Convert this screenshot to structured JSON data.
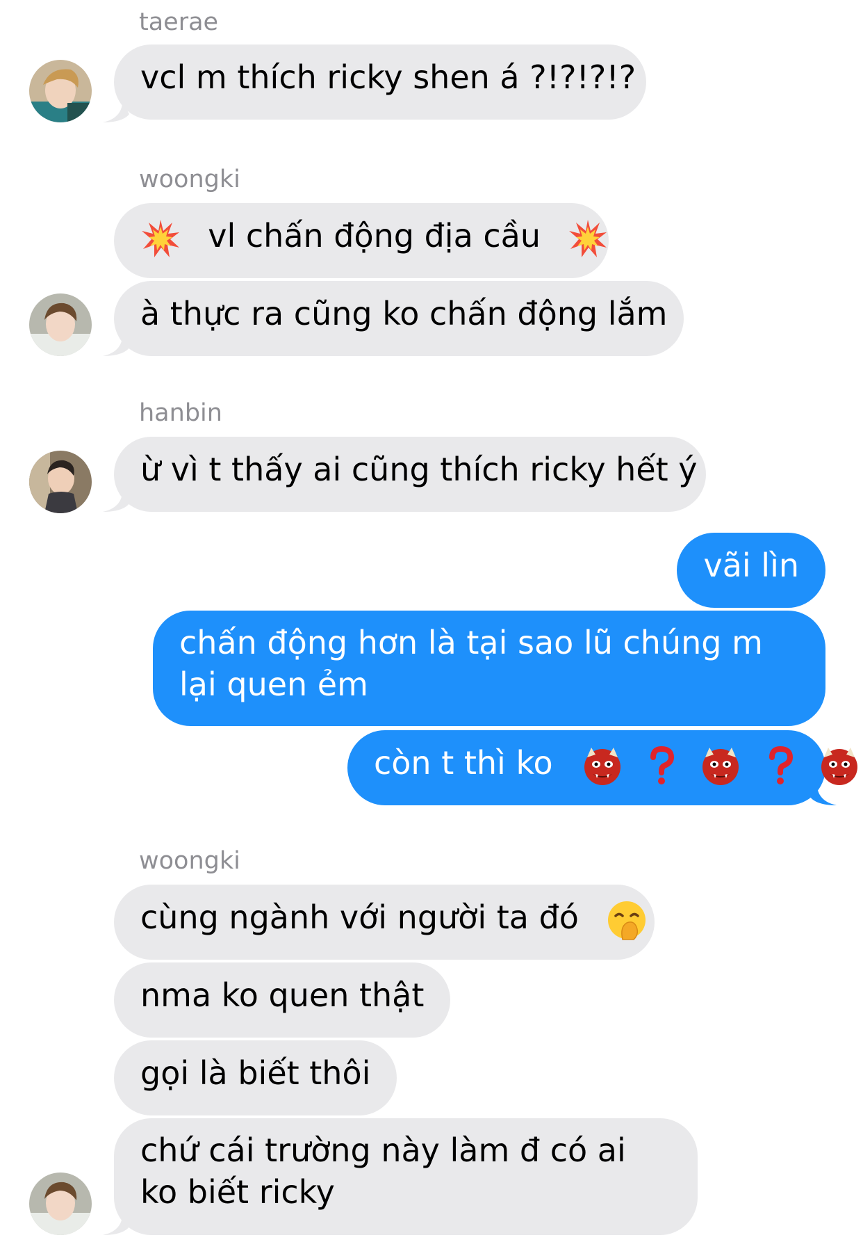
{
  "groups": [
    {
      "sender": "taerae",
      "messages": [
        "vcl m thích ricky shen á ?!?!?!?"
      ]
    },
    {
      "sender": "woongki",
      "messages": [
        "vl chấn động địa cầu",
        "à thực ra cũng ko chấn động lắm"
      ]
    },
    {
      "sender": "hanbin",
      "messages": [
        "ừ vì t thấy ai cũng thích ricky hết ý"
      ]
    },
    {
      "sender": "me",
      "messages": [
        "vãi lìn",
        "chấn động hơn là tại sao lũ chúng m lại quen ẻm",
        "còn t thì ko"
      ]
    },
    {
      "sender": "woongki",
      "messages": [
        "cùng ngành với người ta đó",
        "nma ko quen thật",
        "gọi là biết thôi",
        "chứ cái trường này làm đ có ai ko biết ricky"
      ]
    }
  ],
  "icons": {
    "collision": "collision-emoji-icon",
    "ogre": "ogre-emoji-icon",
    "question": "red-question-mark-icon",
    "peeking": "face-with-hand-over-mouth-emoji-icon"
  },
  "colors": {
    "incoming_bubble": "#e9e9eb",
    "outgoing_bubble": "#1e90fb",
    "sender_label": "#8e8e93"
  }
}
